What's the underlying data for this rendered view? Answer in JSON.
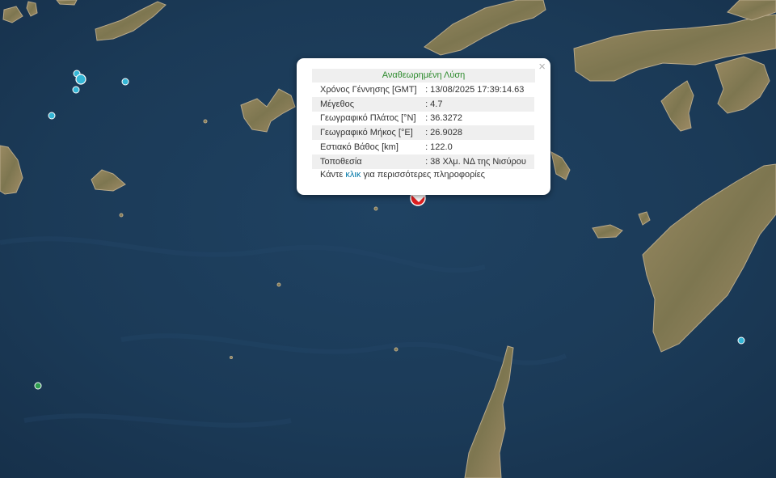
{
  "popup": {
    "title": "Αναθεωρημένη Λύση",
    "close_label": "×",
    "rows": [
      {
        "label": "Χρόνος Γέννησης [GMT]",
        "value": ": 13/08/2025 17:39:14.63"
      },
      {
        "label": "Μέγεθος",
        "value": ": 4.7"
      },
      {
        "label": "Γεωγραφικό Πλάτος [°N]",
        "value": ": 36.3272"
      },
      {
        "label": "Γεωγραφικό Μήκος [°E]",
        "value": ": 26.9028"
      },
      {
        "label": "Εστιακό Βάθος [km]",
        "value": ": 122.0"
      },
      {
        "label": "Τοποθεσία",
        "value": ": 38 Χλμ. ΝΔ της Νισύρου"
      }
    ],
    "more_prefix": "Κάντε ",
    "more_link": "κλικ",
    "more_suffix": " για περισσότερες πληροφορίες"
  },
  "colors": {
    "sea": "#1c3b58",
    "land": "#8b7a55",
    "main_event": "#e02020",
    "recent_event": "#35b6d6",
    "older_event": "#2e9e4f"
  }
}
